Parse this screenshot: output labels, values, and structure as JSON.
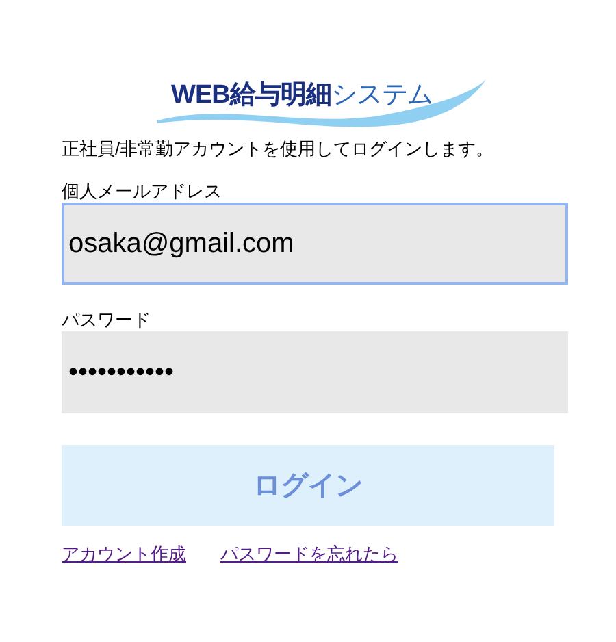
{
  "logo": {
    "main": "WEB給与明細",
    "accent": "システム"
  },
  "intro": "正社員/非常勤アカウントを使用してログインします。",
  "fields": [
    {
      "label": "個人メールアドレス",
      "value": "osaka@gmail.com",
      "focused": true
    },
    {
      "label": "パスワード",
      "value": "•••••••••••",
      "focused": false
    }
  ],
  "login_button": "ログイン",
  "links": [
    "アカウント作成",
    "パスワードを忘れたら"
  ]
}
